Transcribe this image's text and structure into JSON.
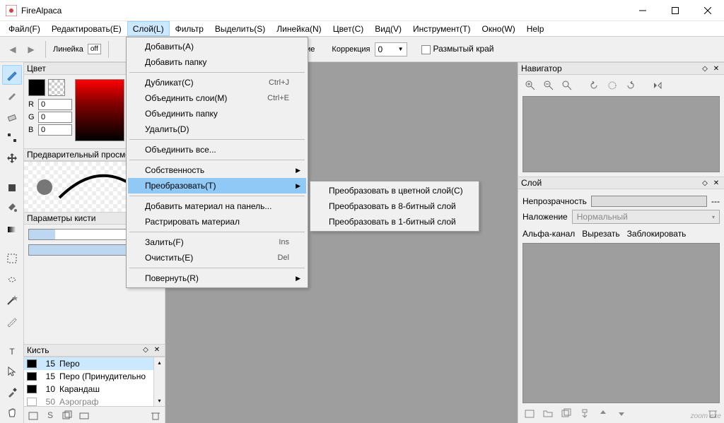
{
  "app": {
    "title": "FireAlpaca"
  },
  "menubar": {
    "items": [
      {
        "label": "Файл(F)"
      },
      {
        "label": "Редактировать(E)"
      },
      {
        "label": "Слой(L)",
        "active": true
      },
      {
        "label": "Фильтр"
      },
      {
        "label": "Выделить(S)"
      },
      {
        "label": "Линейка(N)"
      },
      {
        "label": "Цвет(C)"
      },
      {
        "label": "Вид(V)"
      },
      {
        "label": "Инструмент(T)"
      },
      {
        "label": "Окно(W)"
      },
      {
        "label": "Help"
      }
    ]
  },
  "toolbar": {
    "ruler_label": "Линейка",
    "off_label": "off",
    "antialias_label": "Сглаживание",
    "correction_label": "Коррекция",
    "correction_value": "0",
    "soft_edge_label": "Размытый край"
  },
  "panels": {
    "color": {
      "title": "Цвет",
      "r_label": "R",
      "r_value": "0",
      "g_label": "G",
      "g_value": "0",
      "b_label": "B",
      "b_value": "0"
    },
    "preview": {
      "title": "Предварительный просмотр"
    },
    "brush_params": {
      "title": "Параметры кисти"
    },
    "brush_list": {
      "title": "Кисть",
      "items": [
        {
          "size": "15",
          "name": "Перо",
          "selected": true
        },
        {
          "size": "15",
          "name": "Перо (Принудительно"
        },
        {
          "size": "10",
          "name": "Карандаш"
        },
        {
          "size": "50",
          "name": "Аэрограф"
        }
      ]
    },
    "navigator": {
      "title": "Навигатор"
    },
    "layer": {
      "title": "Слой",
      "opacity_label": "Непрозрачность",
      "opacity_suffix": "---",
      "blend_label": "Наложение",
      "blend_value": "Нормальный",
      "alpha_label": "Альфа-канал",
      "clip_label": "Вырезать",
      "lock_label": "Заблокировать"
    }
  },
  "layer_menu": {
    "items": [
      {
        "label": "Добавить(A)"
      },
      {
        "label": "Добавить папку"
      },
      {
        "sep": true
      },
      {
        "label": "Дубликат(C)",
        "shortcut": "Ctrl+J"
      },
      {
        "label": "Объединить слои(M)",
        "shortcut": "Ctrl+E"
      },
      {
        "label": "Объединить папку"
      },
      {
        "label": "Удалить(D)"
      },
      {
        "sep": true
      },
      {
        "label": "Объединить все..."
      },
      {
        "sep": true
      },
      {
        "label": "Собственность",
        "submenu": true
      },
      {
        "label": "Преобразовать(T)",
        "submenu": true,
        "highlighted": true
      },
      {
        "sep": true
      },
      {
        "label": "Добавить материал на панель..."
      },
      {
        "label": "Растрировать материал"
      },
      {
        "sep": true
      },
      {
        "label": "Залить(F)",
        "shortcut": "Ins"
      },
      {
        "label": "Очистить(E)",
        "shortcut": "Del"
      },
      {
        "sep": true
      },
      {
        "label": "Повернуть(R)",
        "submenu": true
      }
    ]
  },
  "convert_submenu": {
    "items": [
      {
        "label": "Преобразовать в цветной слой(C)"
      },
      {
        "label": "Преобразовать в 8-битный слой"
      },
      {
        "label": "Преобразовать в 1-битный слой"
      }
    ]
  },
  "watermark": "zoom exe"
}
